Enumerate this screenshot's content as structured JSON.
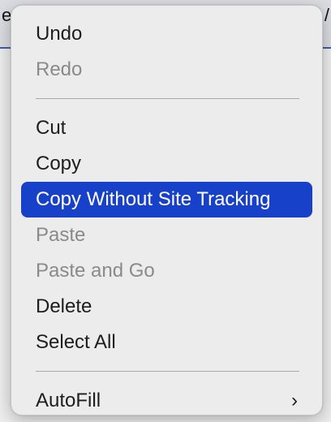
{
  "background": {
    "left_fragment": "e",
    "right_fragment": "/"
  },
  "menu": {
    "groups": [
      [
        {
          "label": "Undo",
          "enabled": true
        },
        {
          "label": "Redo",
          "enabled": false
        }
      ],
      [
        {
          "label": "Cut",
          "enabled": true
        },
        {
          "label": "Copy",
          "enabled": true
        },
        {
          "label": "Copy Without Site Tracking",
          "enabled": true,
          "highlighted": true
        },
        {
          "label": "Paste",
          "enabled": false
        },
        {
          "label": "Paste and Go",
          "enabled": false
        },
        {
          "label": "Delete",
          "enabled": true
        },
        {
          "label": "Select All",
          "enabled": true
        }
      ],
      [
        {
          "label": "AutoFill",
          "enabled": true,
          "submenu_icon": "chevron-right-icon",
          "submenu_glyph": "›"
        }
      ]
    ]
  },
  "colors": {
    "highlight": "#1841c9",
    "disabled_text": "#8a8a8a",
    "menu_background": "#ececec"
  }
}
